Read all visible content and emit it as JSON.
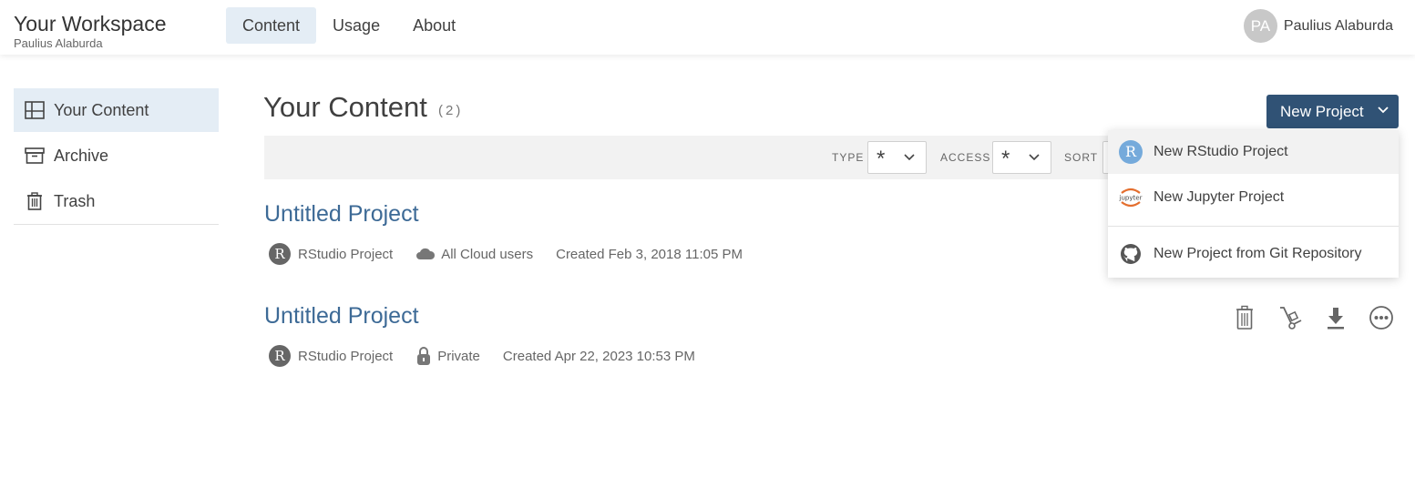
{
  "header": {
    "workspace_title": "Your Workspace",
    "workspace_owner": "Paulius Alaburda",
    "nav": [
      {
        "label": "Content",
        "active": true
      },
      {
        "label": "Usage",
        "active": false
      },
      {
        "label": "About",
        "active": false
      }
    ],
    "user": {
      "initials": "PA",
      "name": "Paulius Alaburda"
    }
  },
  "sidebar": {
    "items": [
      {
        "label": "Your Content",
        "icon": "layout-icon",
        "active": true
      },
      {
        "label": "Archive",
        "icon": "archive-icon",
        "active": false
      },
      {
        "label": "Trash",
        "icon": "trash-icon",
        "active": false
      }
    ]
  },
  "main": {
    "title": "Your Content",
    "count": "(2)",
    "new_project_label": "New Project",
    "filters": {
      "type_label": "TYPE",
      "type_value": "*",
      "access_label": "ACCESS",
      "access_value": "*",
      "sort_label": "SORT"
    },
    "projects": [
      {
        "title": "Untitled Project",
        "type_badge": "R",
        "type": "RStudio Project",
        "access_icon": "cloud-icon",
        "access": "All Cloud users",
        "created": "Created Feb 3, 2018 11:05 PM"
      },
      {
        "title": "Untitled Project",
        "type_badge": "R",
        "type": "RStudio Project",
        "access_icon": "lock-icon",
        "access": "Private",
        "created": "Created Apr 22, 2023 10:53 PM"
      }
    ]
  },
  "dropdown": {
    "items": [
      {
        "label": "New RStudio Project",
        "icon": "rstudio-icon",
        "icon_text": "R"
      },
      {
        "label": "New Jupyter Project",
        "icon": "jupyter-icon",
        "icon_text": "jupyter"
      },
      {
        "label": "New Project from Git Repository",
        "icon": "github-icon"
      }
    ]
  },
  "colors": {
    "accent": "#305275",
    "link": "#3d6a96",
    "active_bg": "#e4edf5",
    "rstudio": "#75aadb",
    "jupyter": "#e46e2e"
  }
}
